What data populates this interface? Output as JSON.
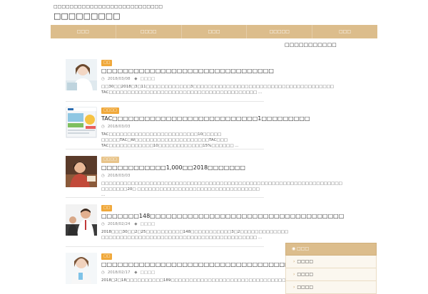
{
  "header": {
    "tagline": "□□□□□□□□□□□□□□□□□□□□□□□□□□□",
    "site_title": "□□□□□□□□□"
  },
  "nav": {
    "items": [
      "□□□",
      "□□□□",
      "□□□",
      "□□□□□",
      "□□□"
    ]
  },
  "posts": [
    {
      "category": "□□",
      "title": "□□□□□□□□□□□□□□□□□□□□□□□□□□□□□□□□",
      "date": "2018/03/08",
      "tag": "□□□□",
      "excerpt": "□□30□□2018□3□11□□□□□□□□□□□□3□□□□□□□□□□□□□□□□□□□□□□□□□□□□□□□□□□□□□□ TAC□□□□□□□□□□□□□□□□□□□□□□□□□□□□□□□□□□□□□□□□ ..."
    },
    {
      "category": "□□□□",
      "title": "TAC□□□□□□□□□□□□□□□□□□□□□□□□□□□1□□□□□□□□□",
      "date": "2018/03/03",
      "tag": "",
      "excerpt": "TAC□□□□□□□□□□□□□□□□□□□□□□□□10□□□□□ □□□□□TAC□W□□□□□□□□□□□□□□□□□□□□TAC□□□ TAC□□□□□□□□□□□□10□□□□□□□□□□□□15%□□□□□□ ..."
    },
    {
      "category": "□□□□",
      "title": "□□□□□□□□□□□□1,000□□2018□□□□□□□",
      "date": "2018/03/03",
      "tag": "",
      "excerpt": "□□□□□□□□□□□□□□□□□□□□□□□□□□□□□□□□□□□□□□□□□□□□□□□□□□□□□□□□□□□□□□□□□ □□□□□□□20□ □□□□□□□□□□□□□□□□□□□□□□□□□□□□□□□□□ ..."
    },
    {
      "category": "□□",
      "title": "□□□□□□□148□□□□□□□□□□□□□□□□□□□□□□□□□□□□□□□□□□□□",
      "date": "2018/02/24",
      "tag": "□□□□",
      "excerpt": "2018□□□30□□2□25□□□□□□□□□□148□□□□□□□□□□□3□2□□□□□□□□□□□□□ □□□□□□□□□□□□□□□□□□□□□□□□□□□□□□□□□□□□□□□□□□ ..."
    },
    {
      "category": "□□",
      "title": "□□□□□□□□□□□□□□□□□□□□□□□□□□□□□□□□□□□□□□□",
      "date": "2018/02/17",
      "tag": "□□□□",
      "excerpt": "2018□2□18□□□□□□□□□□189□□□□□□□□□□□□□□□□□□□□□□□□□□□□□□□□□□□□□□□□□□□□"
    }
  ],
  "sidebar": {
    "title": "□□□□□□□□□□□",
    "box_heading": "□□□",
    "links": [
      "□□□□",
      "□□□□",
      "□□□□"
    ]
  },
  "colors": {
    "nav_bg": "#dcbd8c",
    "category_badge": "#f0a83a"
  }
}
